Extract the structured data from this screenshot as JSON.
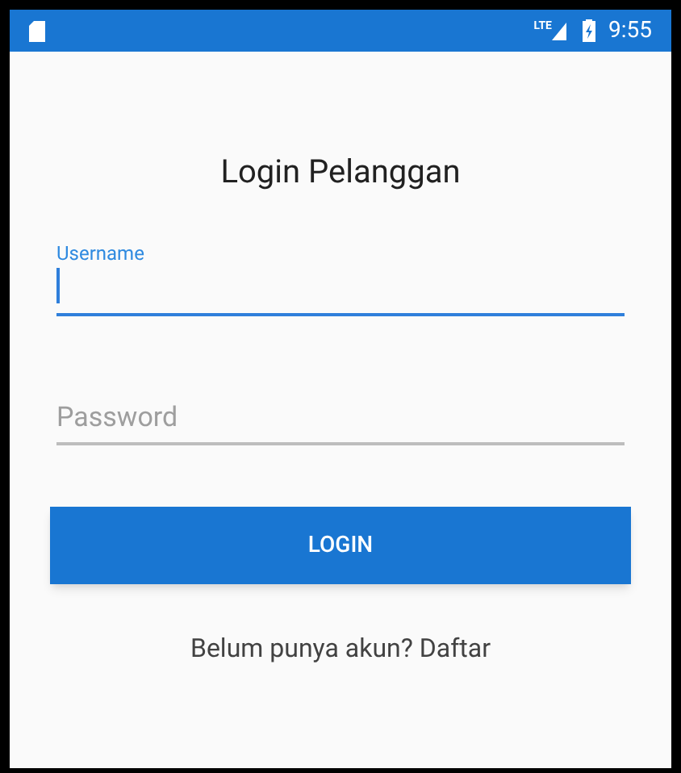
{
  "status_bar": {
    "time": "9:55",
    "network": "LTE"
  },
  "title": "Login Pelanggan",
  "fields": [
    {
      "label": "Username",
      "focused": true
    },
    {
      "placeholder": "Password",
      "focused": false
    }
  ],
  "login_button": "LOGIN",
  "register_link": "Belum punya akun? Daftar"
}
